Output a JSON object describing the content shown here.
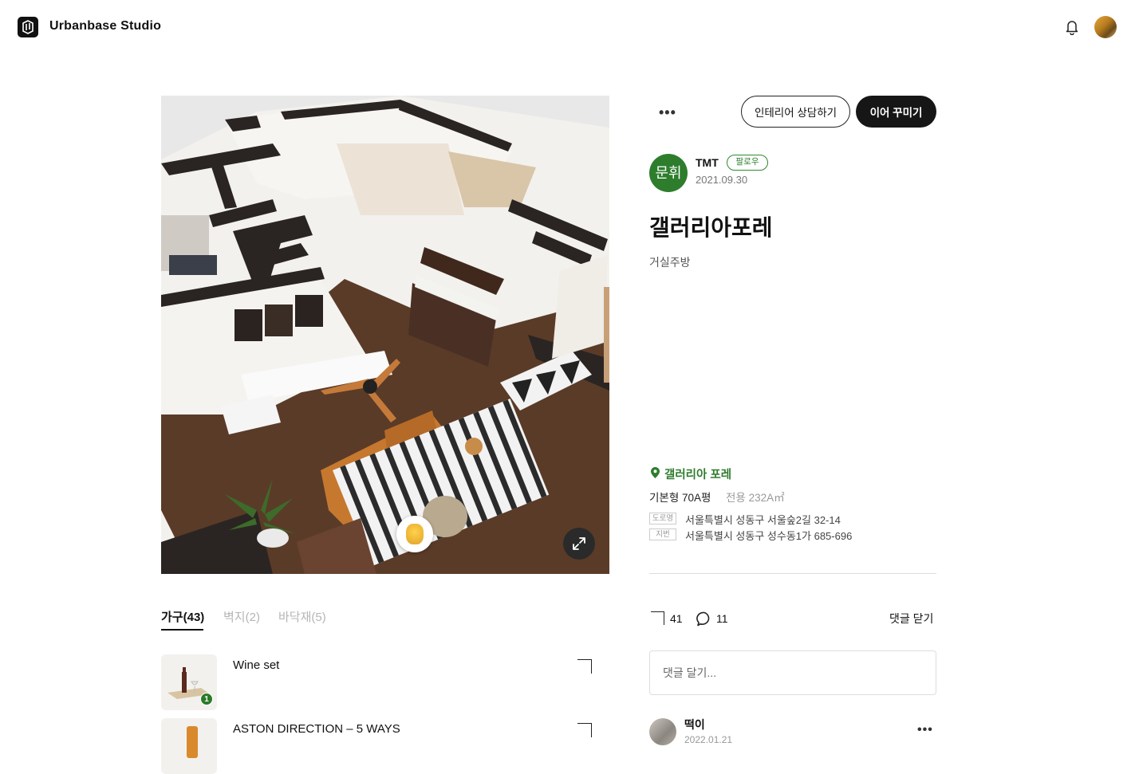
{
  "header": {
    "brand": "Urbanbase Studio"
  },
  "scene": {
    "description_icons": [
      "expand-icon",
      "hotspot-marker"
    ]
  },
  "tabs": [
    {
      "label": "가구(43)",
      "active": true
    },
    {
      "label": "벽지(2)",
      "active": false
    },
    {
      "label": "바닥재(5)",
      "active": false
    }
  ],
  "items": [
    {
      "name": "Wine set",
      "count": "1"
    },
    {
      "name": "ASTON DIRECTION – 5 WAYS",
      "count": ""
    }
  ],
  "actions": {
    "more": "•••",
    "consult_label": "인테리어 상담하기",
    "continue_label": "이어 꾸미기"
  },
  "author": {
    "avatar_text": "문휘",
    "name": "TMT",
    "follow_label": "팔로우",
    "date": "2021.09.30"
  },
  "post": {
    "title": "갤러리아포레",
    "subtitle": "거실주방"
  },
  "place": {
    "name": "갤러리아 포레",
    "plan_type": "기본형 70A평",
    "area": "전용 232A㎡",
    "road_tag": "도로명",
    "road_address": "서울특별시 성동구 서울숲2길 32-14",
    "lot_tag": "지번",
    "lot_address": "서울특별시 성동구 성수동1가 685-696"
  },
  "stats": {
    "likes": "41",
    "comments": "11",
    "close_comments_label": "댓글 닫기"
  },
  "comment_box": {
    "placeholder": "댓글 달기..."
  },
  "comments": [
    {
      "name": "떡이",
      "date": "2022.01.21",
      "more": "•••"
    }
  ],
  "colors": {
    "accent_green": "#2d7d2d",
    "dark_button": "#161616"
  }
}
